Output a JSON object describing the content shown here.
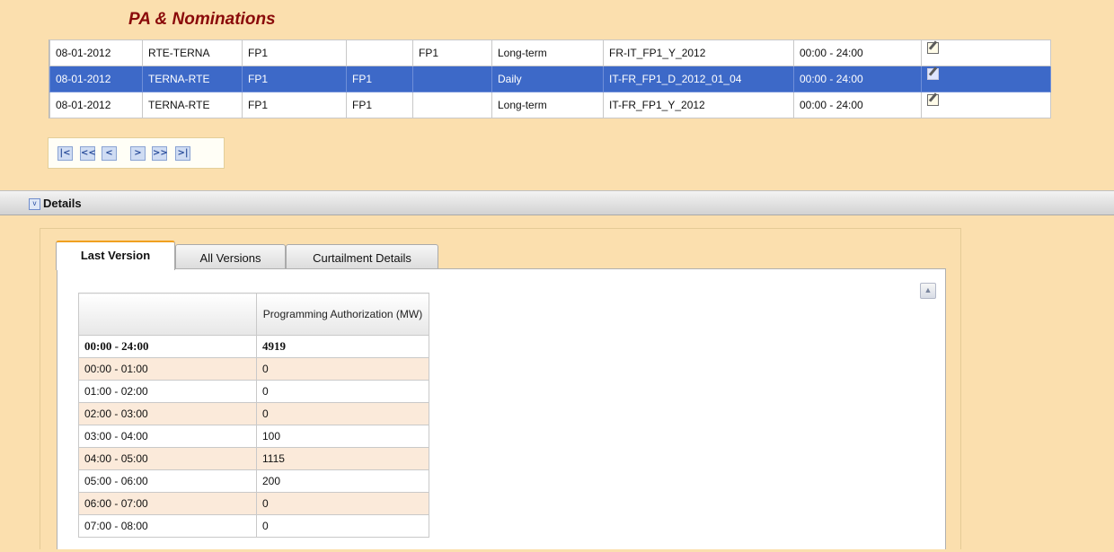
{
  "page": {
    "title": "PA & Nominations"
  },
  "rows": [
    {
      "date": "08-01-2012",
      "direction": "RTE-TERNA",
      "product": "FP1",
      "col4": "",
      "col5": "FP1",
      "type": "Long-term",
      "code": "FR-IT_FP1_Y_2012",
      "period": "00:00 - 24:00",
      "selected": false
    },
    {
      "date": "08-01-2012",
      "direction": "TERNA-RTE",
      "product": "FP1",
      "col4": "FP1",
      "col5": "",
      "type": "Daily",
      "code": "IT-FR_FP1_D_2012_01_04",
      "period": "00:00 - 24:00",
      "selected": true
    },
    {
      "date": "08-01-2012",
      "direction": "TERNA-RTE",
      "product": "FP1",
      "col4": "FP1",
      "col5": "",
      "type": "Long-term",
      "code": "IT-FR_FP1_Y_2012",
      "period": "00:00 - 24:00",
      "selected": false
    }
  ],
  "pager": {
    "first": "|<",
    "prev_fast": "<<",
    "prev": "<",
    "next": ">",
    "next_fast": ">>",
    "last": ">|"
  },
  "details": {
    "label": "Details",
    "toggle": "v",
    "tabs": [
      "Last Version",
      "All Versions",
      "Curtailment Details"
    ],
    "pa_table": {
      "column_header": "Programming Authorization (MW)",
      "total": {
        "period": "00:00 - 24:00",
        "value": "4919"
      },
      "rows": [
        {
          "period": "00:00 - 01:00",
          "value": "0"
        },
        {
          "period": "01:00 - 02:00",
          "value": "0"
        },
        {
          "period": "02:00 - 03:00",
          "value": "0"
        },
        {
          "period": "03:00 - 04:00",
          "value": "100"
        },
        {
          "period": "04:00 - 05:00",
          "value": "1115"
        },
        {
          "period": "05:00 - 06:00",
          "value": "200"
        },
        {
          "period": "06:00 - 07:00",
          "value": "0"
        },
        {
          "period": "07:00 - 08:00",
          "value": "0"
        }
      ]
    }
  },
  "colors": {
    "background": "#fbdfae",
    "title": "#8a0a0a",
    "selected_row": "#3d69c8",
    "alt_row": "#fbeada"
  }
}
